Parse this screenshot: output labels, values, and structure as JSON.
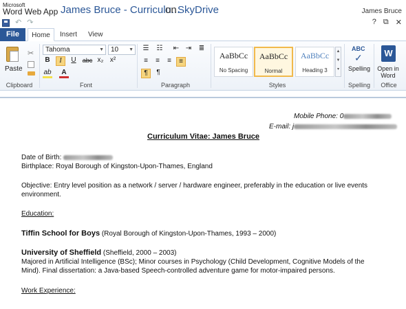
{
  "app": {
    "brand_small": "Microsoft",
    "brand_big": "Word Web App",
    "document_title": "James Bruce - Curriculu...",
    "on_label": "on",
    "service": "SkyDrive",
    "user": "James Bruce"
  },
  "quick_access": {
    "save": "save-icon",
    "undo": "↶",
    "redo": "↷"
  },
  "window_controls": {
    "help": "?",
    "restore": "⧉",
    "close": "✕"
  },
  "tabs": {
    "file": "File",
    "home": "Home",
    "insert": "Insert",
    "view": "View"
  },
  "ribbon": {
    "clipboard": {
      "paste": "Paste",
      "group": "Clipboard",
      "cut_glyph": "✂"
    },
    "font": {
      "family": "Tahoma",
      "size": "10",
      "group": "Font",
      "bold": "B",
      "italic": "I",
      "underline": "U",
      "strike": "abc",
      "subscript": "x₂",
      "superscript": "x²",
      "highlight": "ab",
      "color": "A"
    },
    "paragraph": {
      "group": "Paragraph"
    },
    "styles": {
      "group": "Styles",
      "items": [
        {
          "sample": "AaBbCc",
          "name": "No Spacing"
        },
        {
          "sample": "AaBbCc",
          "name": "Normal"
        },
        {
          "sample": "AaBbCc",
          "name": "Heading 3"
        }
      ]
    },
    "spelling": {
      "label": "Spelling",
      "glyph": "ABC",
      "check": "✓",
      "group": "Spelling"
    },
    "office": {
      "label_line1": "Open in",
      "label_line2": "Word",
      "glyph": "W",
      "group": "Office"
    }
  },
  "document": {
    "mobile_label": "Mobile Phone: 0",
    "email_label": "E-mail: j",
    "title": "Curriculum Vitae: James Bruce",
    "dob_label": "Date of Birth:",
    "birthplace": "Birthplace: Royal Borough of Kingston-Upon-Thames, England",
    "objective_1": "Objective: Entry level position as a network / server / hardware engineer, preferably in the education or live events",
    "objective_2": "environment.",
    "education_heading": "Education:",
    "school_name": "Tiffin School for Boys",
    "school_detail": " (Royal Borough of Kingston-Upon-Thames, 1993 – 2000)",
    "uni_name": "University of Sheffield",
    "uni_detail": " (Sheffield, 2000 – 2003)",
    "uni_line_1": "Majored in Artificial Intelligence (BSc); Minor courses in Psychology (Child Development, Cognitive Models of the",
    "uni_line_2": "Mind). Final dissertation: a Java-based Speech-controlled adventure game for motor-impaired persons.",
    "work_heading": "Work Experience:"
  },
  "colors": {
    "accent": "#2b5797",
    "selected_style": "#f1b94b"
  }
}
